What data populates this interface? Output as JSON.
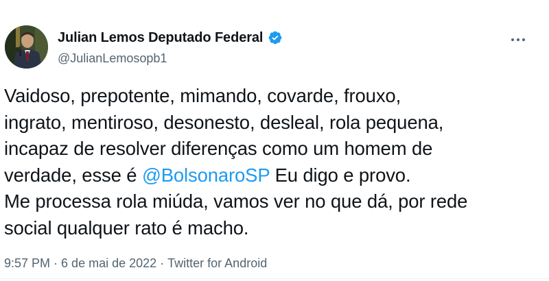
{
  "author": {
    "display_name": "Julian Lemos Deputado Federal",
    "handle": "@JulianLemosopb1",
    "verified": true
  },
  "more_button": {
    "icon": "more-horizontal-icon"
  },
  "tweet": {
    "lines": [
      {
        "text": "Vaidoso, prepotente, mimando, covarde, frouxo,"
      },
      {
        "text": "ingrato, mentiroso, desonesto, desleal, rola pequena,"
      },
      {
        "text": "incapaz de resolver diferenças como um homem de"
      },
      {
        "before": "verdade, esse é ",
        "mention": "@BolsonaroSP",
        "after": " Eu digo e provo."
      },
      {
        "text": "Me processa rola miúda, vamos ver no que dá, por rede"
      },
      {
        "text": "social qualquer rato é macho."
      }
    ]
  },
  "meta": {
    "time": "9:57 PM",
    "separator": "·",
    "date": "6 de mai de 2022",
    "source": "Twitter for Android"
  },
  "colors": {
    "link": "#1d9bf0",
    "text": "#0f1419",
    "secondary": "#536471",
    "verified": "#1d9bf0"
  }
}
